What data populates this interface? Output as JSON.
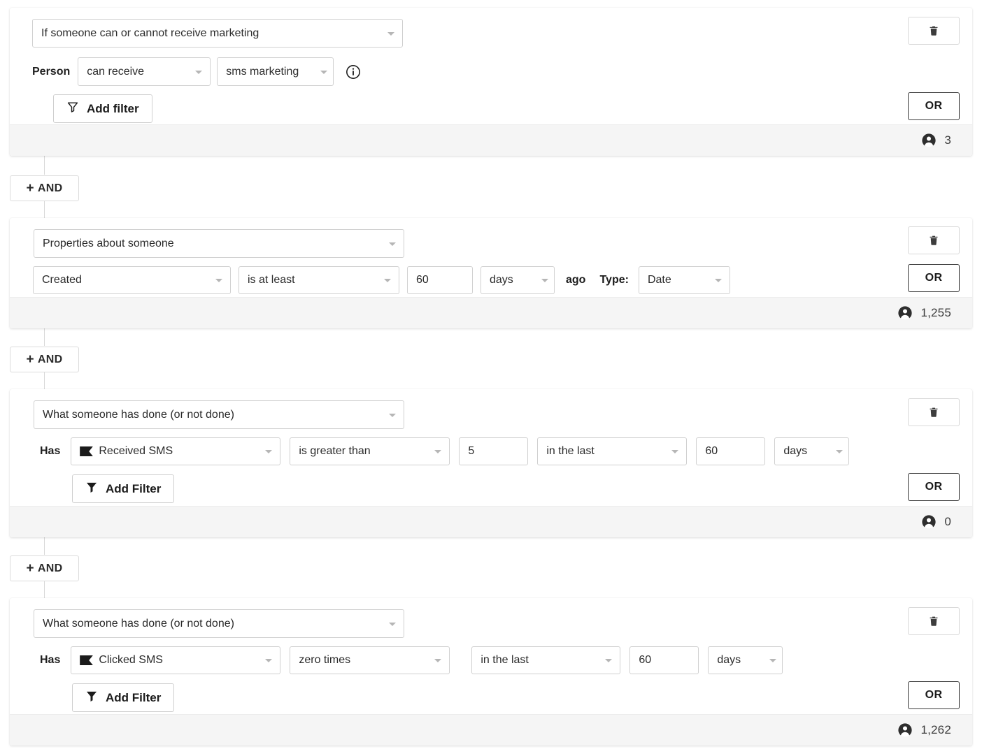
{
  "colors": {
    "card_bg": "#ffffff",
    "footer_bg": "#f5f5f5",
    "border": "#d0d0d0",
    "text": "#2b2b2b",
    "connector": "#d8d8d8"
  },
  "connector": {
    "and_label": "AND",
    "plus": "+"
  },
  "blocks": [
    {
      "type_label": "If someone can or cannot receive marketing",
      "row_label": "Person",
      "fields": [
        {
          "kind": "select",
          "value": "can receive"
        },
        {
          "kind": "select",
          "value": "sms marketing"
        },
        {
          "kind": "icon",
          "value": "info-icon"
        }
      ],
      "add_filter_label": "Add filter",
      "add_filter_icon": "funnel-outline-icon",
      "delete_icon": "trash-icon",
      "or_label": "OR",
      "count": "3"
    },
    {
      "type_label": "Properties about someone",
      "row_label": "",
      "fields": [
        {
          "kind": "select",
          "value": "Created"
        },
        {
          "kind": "select",
          "value": "is at least"
        },
        {
          "kind": "text",
          "value": "60"
        },
        {
          "kind": "select",
          "value": "days"
        },
        {
          "kind": "word",
          "value": "ago"
        },
        {
          "kind": "word",
          "value": "Type:"
        },
        {
          "kind": "select",
          "value": "Date"
        }
      ],
      "add_filter_label": "",
      "delete_icon": "trash-icon",
      "or_label": "OR",
      "count": "1,255"
    },
    {
      "type_label": "What someone has done (or not done)",
      "row_label": "Has",
      "fields": [
        {
          "kind": "select",
          "value": "Received SMS",
          "icon": "flag-icon"
        },
        {
          "kind": "select",
          "value": "is greater than"
        },
        {
          "kind": "text",
          "value": "5"
        },
        {
          "kind": "select",
          "value": "in the last"
        },
        {
          "kind": "text",
          "value": "60"
        },
        {
          "kind": "select",
          "value": "days"
        }
      ],
      "add_filter_label": "Add Filter",
      "add_filter_icon": "funnel-filled-icon",
      "delete_icon": "trash-icon",
      "or_label": "OR",
      "count": "0"
    },
    {
      "type_label": "What someone has done (or not done)",
      "row_label": "Has",
      "fields": [
        {
          "kind": "select",
          "value": "Clicked SMS",
          "icon": "flag-icon"
        },
        {
          "kind": "select",
          "value": "zero times"
        },
        {
          "kind": "select",
          "value": "in the last"
        },
        {
          "kind": "text",
          "value": "60"
        },
        {
          "kind": "select",
          "value": "days"
        }
      ],
      "add_filter_label": "Add Filter",
      "add_filter_icon": "funnel-filled-icon",
      "delete_icon": "trash-icon",
      "or_label": "OR",
      "count": "1,262"
    }
  ]
}
